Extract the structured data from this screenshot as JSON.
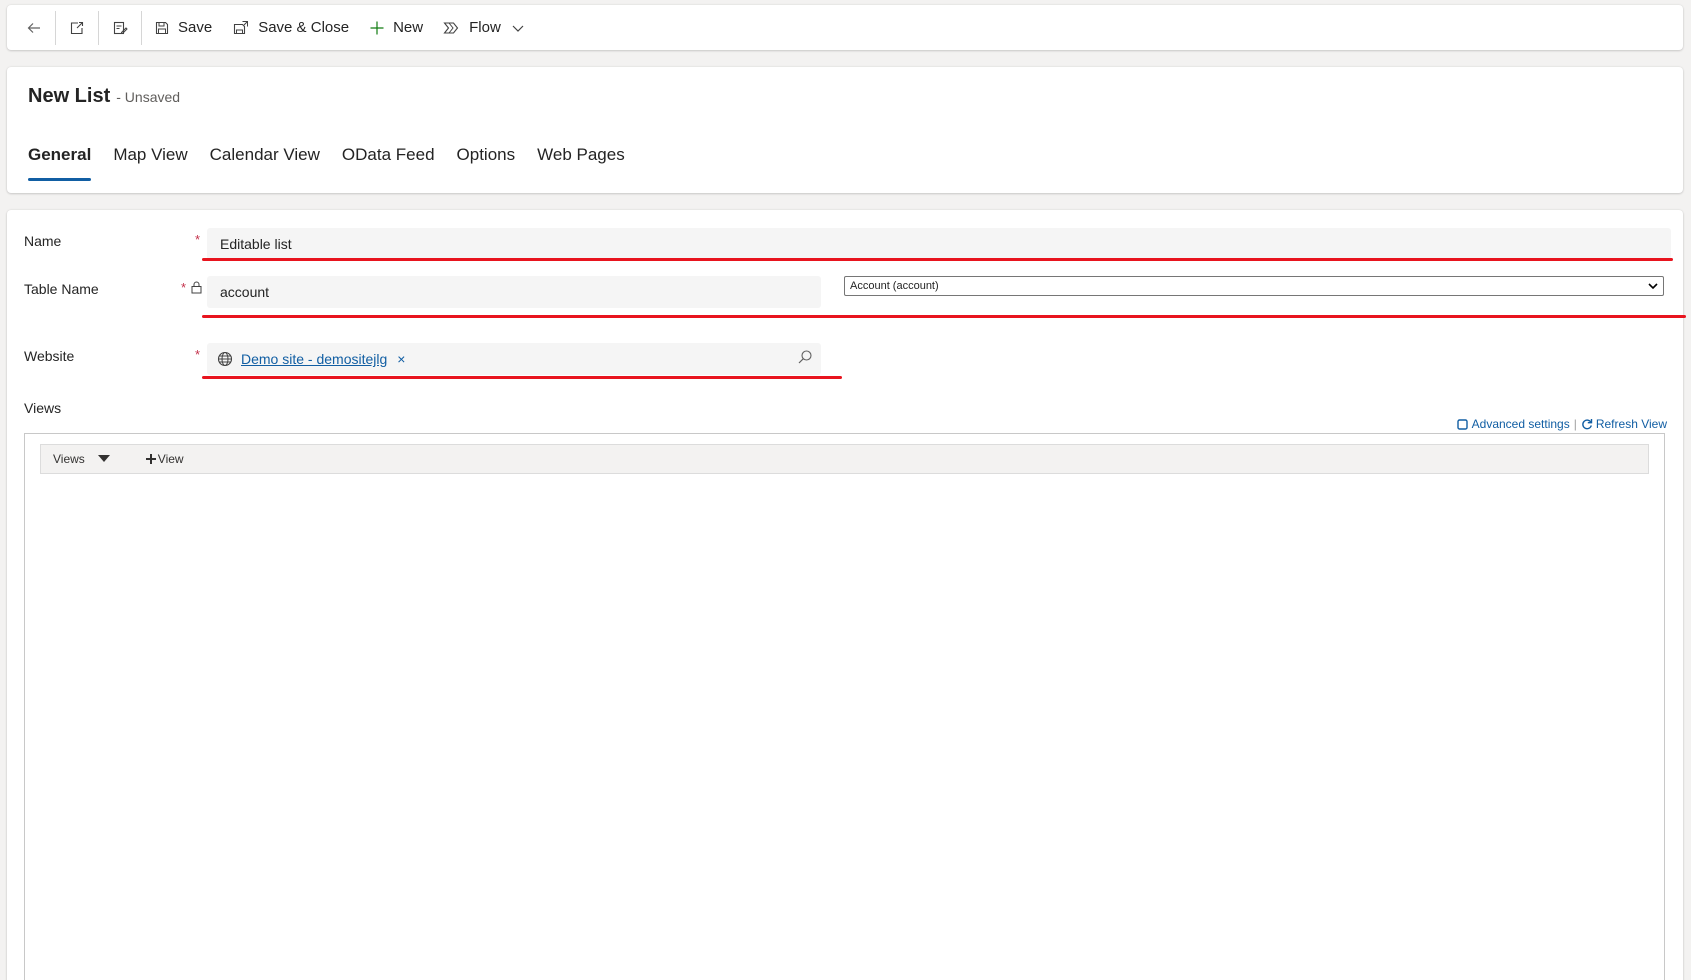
{
  "command_bar": {
    "back_icon": "arrow-left-icon",
    "popout_icon": "open-in-new-window-icon",
    "form_icon": "form-edit-icon",
    "save_label": "Save",
    "save_close_label": "Save & Close",
    "new_label": "New",
    "flow_label": "Flow"
  },
  "header": {
    "title": "New List",
    "status": "- Unsaved",
    "tabs": [
      {
        "label": "General",
        "active": true
      },
      {
        "label": "Map View"
      },
      {
        "label": "Calendar View"
      },
      {
        "label": "OData Feed"
      },
      {
        "label": "Options"
      },
      {
        "label": "Web Pages"
      }
    ]
  },
  "form": {
    "required_mark": "*",
    "name": {
      "label": "Name",
      "value": "Editable list"
    },
    "table_name": {
      "label": "Table Name",
      "value": "account",
      "select_value": "Account (account)"
    },
    "website": {
      "label": "Website",
      "value": "Demo site - demositejlg",
      "remove_glyph": "×"
    },
    "views": {
      "label": "Views",
      "advanced_settings": "Advanced settings",
      "separator": "|",
      "refresh_view": "Refresh View",
      "toolbar_views": "Views",
      "toolbar_add": "View"
    }
  },
  "colors": {
    "accent": "#115ea3",
    "highlight_underline": "#e8141e",
    "required": "#c4314b"
  }
}
